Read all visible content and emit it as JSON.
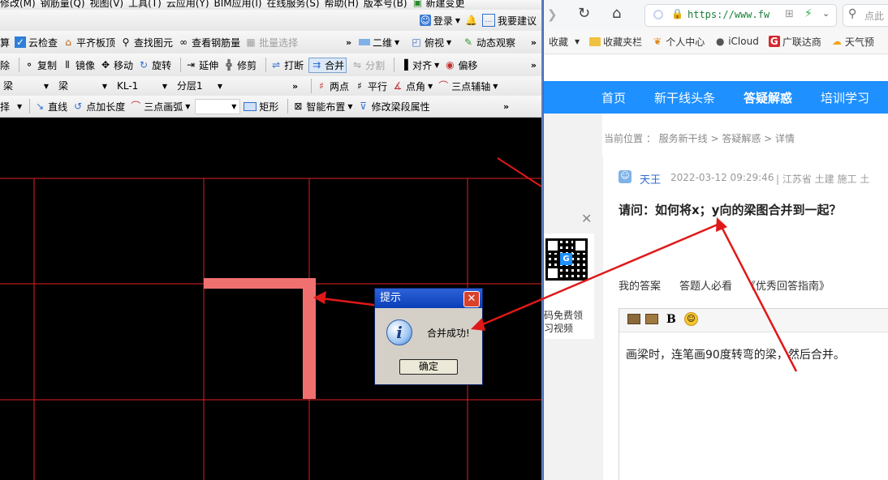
{
  "cad": {
    "menu": [
      "修改(M)",
      "钢筋量(Q)",
      "视图(V)",
      "工具(T)",
      "云应用(Y)",
      "BIM应用(I)",
      "在线服务(S)",
      "帮助(H)",
      "版本号(B)",
      "新建变更"
    ],
    "login_label": "登录",
    "suggest_label": "我要建议",
    "toolbar2": [
      "算",
      "云检查",
      "平齐板顶",
      "查找图元",
      "查看钢筋量",
      "批量选择",
      "二维",
      "俯视",
      "动态观察"
    ],
    "toolbar3": [
      "除",
      "复制",
      "镜像",
      "移动",
      "旋转",
      "延伸",
      "修剪",
      "打断",
      "合并",
      "分割",
      "对齐",
      "偏移"
    ],
    "toolbar4": {
      "dropdowns": [
        "梁",
        "梁",
        "KL-1",
        "分层1"
      ],
      "tools": [
        "两点",
        "平行",
        "点角",
        "三点辅轴"
      ]
    },
    "toolbar5": [
      "择",
      "直线",
      "点加长度",
      "三点画弧",
      "矩形",
      "智能布置",
      "修改梁段属性"
    ]
  },
  "dialog": {
    "title": "提示",
    "message": "合并成功!",
    "ok_label": "确定"
  },
  "browser": {
    "url": "https://www.fw",
    "search_placeholder": "点此",
    "bookmarks": [
      "收藏",
      "收藏夹栏",
      "个人中心",
      "iCloud",
      "广联达商",
      "天气预"
    ],
    "site_nav": [
      "首页",
      "新干线头条",
      "答疑解惑",
      "培训学习"
    ],
    "breadcrumb": "当前位置 ： 服务新干线 > 答疑解惑 > 详情",
    "author": "天王",
    "post_time": "2022-03-12 09:29:46",
    "post_meta": "|   江苏省 土建 施工 土",
    "question": "请问：如何将x；y向的梁图合并到一起？",
    "qr_caption_1": "码免费领",
    "qr_caption_2": "习视频",
    "answer_tabs": [
      "我的答案",
      "答题人必看",
      "《优秀回答指南》"
    ],
    "bold_button": "B",
    "answer_text": "画梁时，连笔画90度转弯的梁，然后合并。"
  },
  "colors": {
    "cad_background": "#000000",
    "grid_line": "#e0201f",
    "beam": "#f07070",
    "annotation_arrow": "#e01818",
    "site_nav": "#1e90ff"
  }
}
